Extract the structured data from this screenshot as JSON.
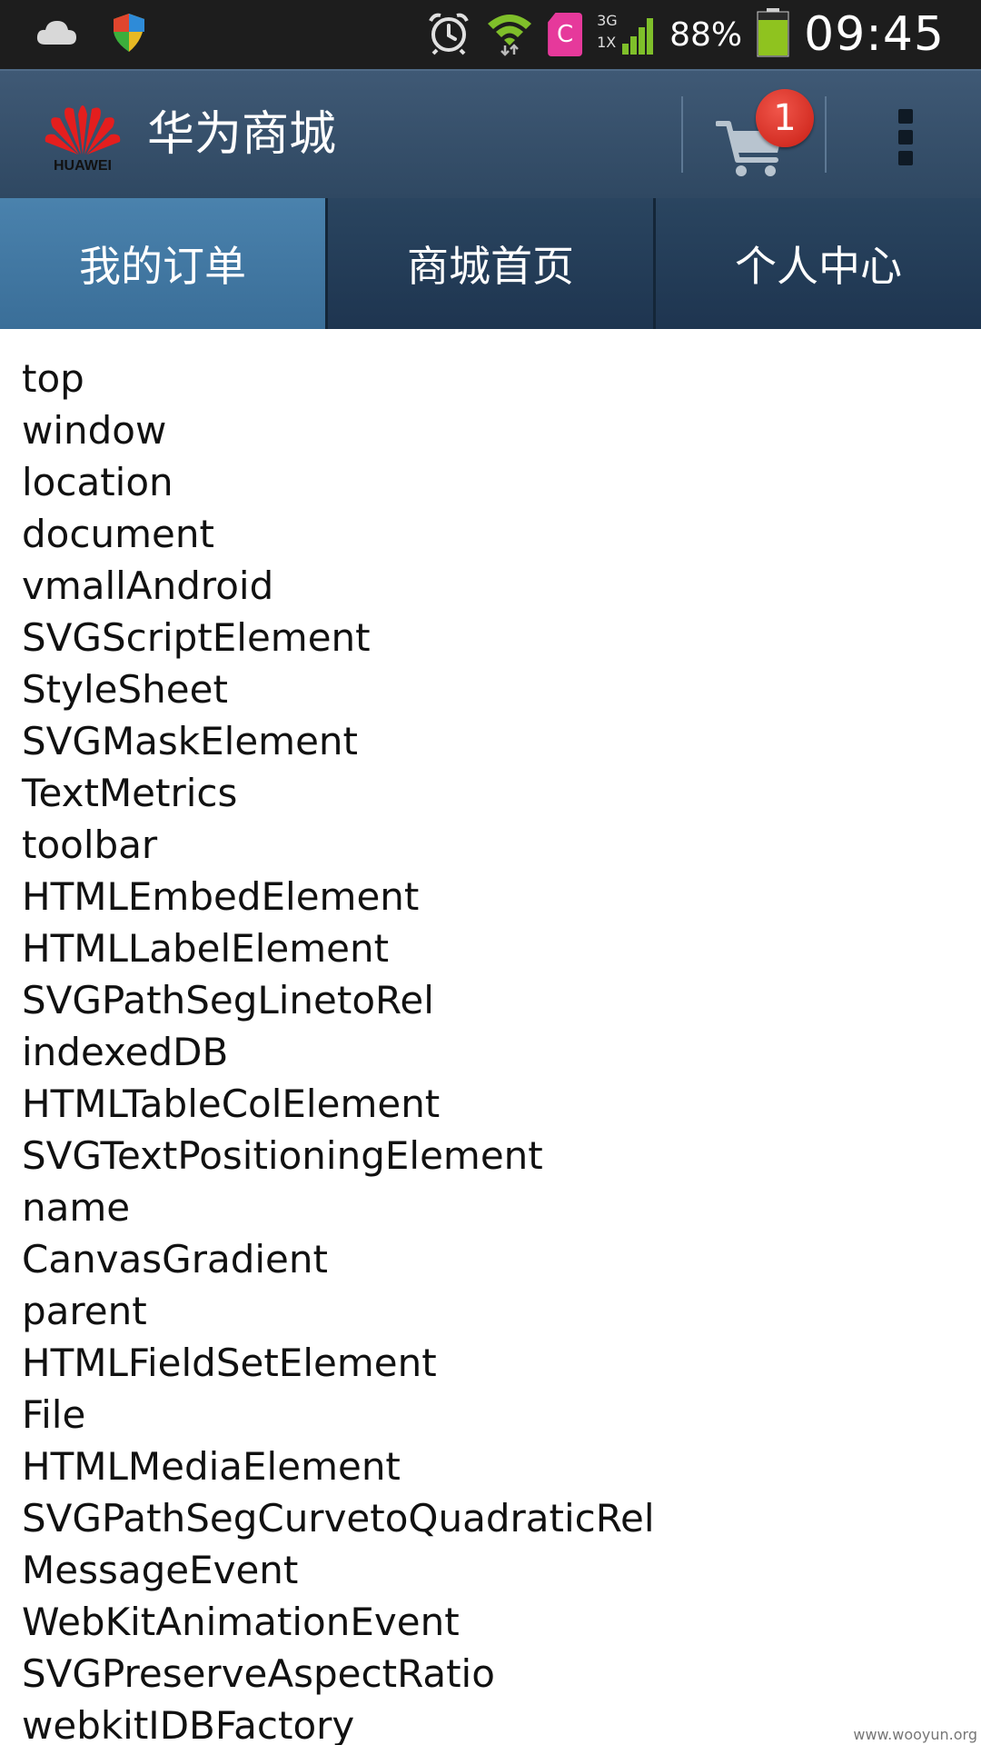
{
  "status_bar": {
    "left_icons": [
      "cloud-icon",
      "shield-icon"
    ],
    "right_icons": [
      "alarm-icon",
      "wifi-icon",
      "sim-card-icon",
      "signal-icon",
      "battery-icon"
    ],
    "network_top": "3G",
    "network_bottom": "1X",
    "sim_label": "C",
    "battery_percent": "88%",
    "battery_level": 0.88,
    "time": "09:45"
  },
  "action_bar": {
    "logo_text": "HUAWEI",
    "title": "华为商城",
    "cart_badge_count": "1",
    "icons": [
      "huawei-logo-icon",
      "cart-icon",
      "overflow-menu-icon"
    ]
  },
  "tabs": [
    {
      "label": "我的订单",
      "active": true
    },
    {
      "label": "商城首页",
      "active": false
    },
    {
      "label": "个人中心",
      "active": false
    }
  ],
  "content": {
    "items": [
      "top",
      "window",
      "location",
      "document",
      "vmallAndroid",
      "SVGScriptElement",
      "StyleSheet",
      "SVGMaskElement",
      "TextMetrics",
      "toolbar",
      "HTMLEmbedElement",
      "HTMLLabelElement",
      "SVGPathSegLinetoRel",
      "indexedDB",
      "HTMLTableColElement",
      "SVGTextPositioningElement",
      "name",
      "CanvasGradient",
      "parent",
      "HTMLFieldSetElement",
      "File",
      "HTMLMediaElement",
      "SVGPathSegCurvetoQuadraticRel",
      "MessageEvent",
      "WebKitAnimationEvent",
      "SVGPreserveAspectRatio",
      "webkitIDBFactory"
    ]
  },
  "watermark": "www.wooyun.org",
  "colors": {
    "status_bar_bg": "#1d1d1d",
    "action_bar_bg": "#3a536e",
    "tab_active_bg": "#4479a3",
    "tab_inactive_bg": "#243d57",
    "badge": "#d9261c",
    "battery_fill": "#8fc31f"
  }
}
